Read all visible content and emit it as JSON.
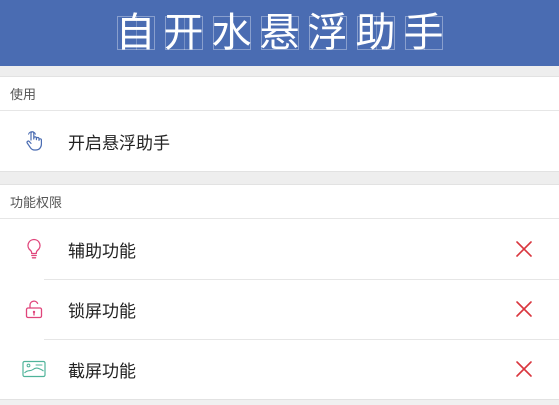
{
  "header": {
    "title_chars": [
      "自",
      "开",
      "水",
      "悬",
      "浮",
      "助",
      "手"
    ],
    "background": "#4a6cb2"
  },
  "sections": [
    {
      "title": "使用",
      "items": [
        {
          "label": "开启悬浮助手",
          "icon": "hand-pointer-icon"
        }
      ]
    },
    {
      "title": "功能权限",
      "items": [
        {
          "label": "辅助功能",
          "icon": "lightbulb-icon",
          "status": "disabled"
        },
        {
          "label": "锁屏功能",
          "icon": "unlock-icon",
          "status": "disabled"
        },
        {
          "label": "截屏功能",
          "icon": "image-icon",
          "status": "disabled"
        }
      ]
    }
  ],
  "colors": {
    "close": "#d9363e",
    "icon_pink": "#e0457b",
    "icon_teal": "#4fb39a",
    "icon_blue": "#4a6cb2"
  }
}
